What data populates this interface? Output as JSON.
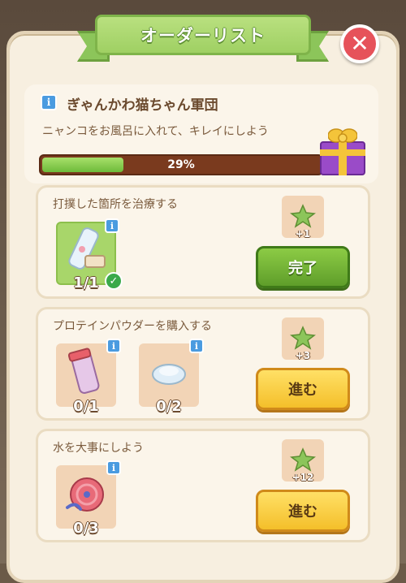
{
  "header": {
    "title": "オーダーリスト",
    "close_icon": "close-icon"
  },
  "order": {
    "title": "ぎゃんかわ猫ちゃん軍団",
    "description": "ニャンコをお風呂に入れて、キレイにしよう",
    "progress_percent": 29,
    "progress_label": "29%",
    "reward_icon": "gift-icon"
  },
  "tasks": [
    {
      "label": "打撲した箇所を治療する",
      "items": [
        {
          "icon": "bandage-bottle-icon",
          "count": "1/1",
          "completed": true
        }
      ],
      "reward": "+1",
      "button": "完了",
      "button_state": "complete"
    },
    {
      "label": "プロテインパウダーを購入する",
      "items": [
        {
          "icon": "protein-shaker-icon",
          "count": "0/1",
          "completed": false
        },
        {
          "icon": "powder-pile-icon",
          "count": "0/2",
          "completed": false
        }
      ],
      "reward": "+3",
      "button": "進む",
      "button_state": "go"
    },
    {
      "label": "水を大事にしよう",
      "items": [
        {
          "icon": "hose-reel-icon",
          "count": "0/3",
          "completed": false
        }
      ],
      "reward": "+12",
      "button": "進む",
      "button_state": "go"
    }
  ],
  "colors": {
    "ribbon_green": "#9fd063",
    "progress_fill": "#6dbb3a",
    "progress_track": "#7a3a1e",
    "button_complete": "#5f9e2a",
    "button_go": "#f4bf2a",
    "close_red": "#e6525a",
    "panel_bg": "#f7efe0"
  }
}
